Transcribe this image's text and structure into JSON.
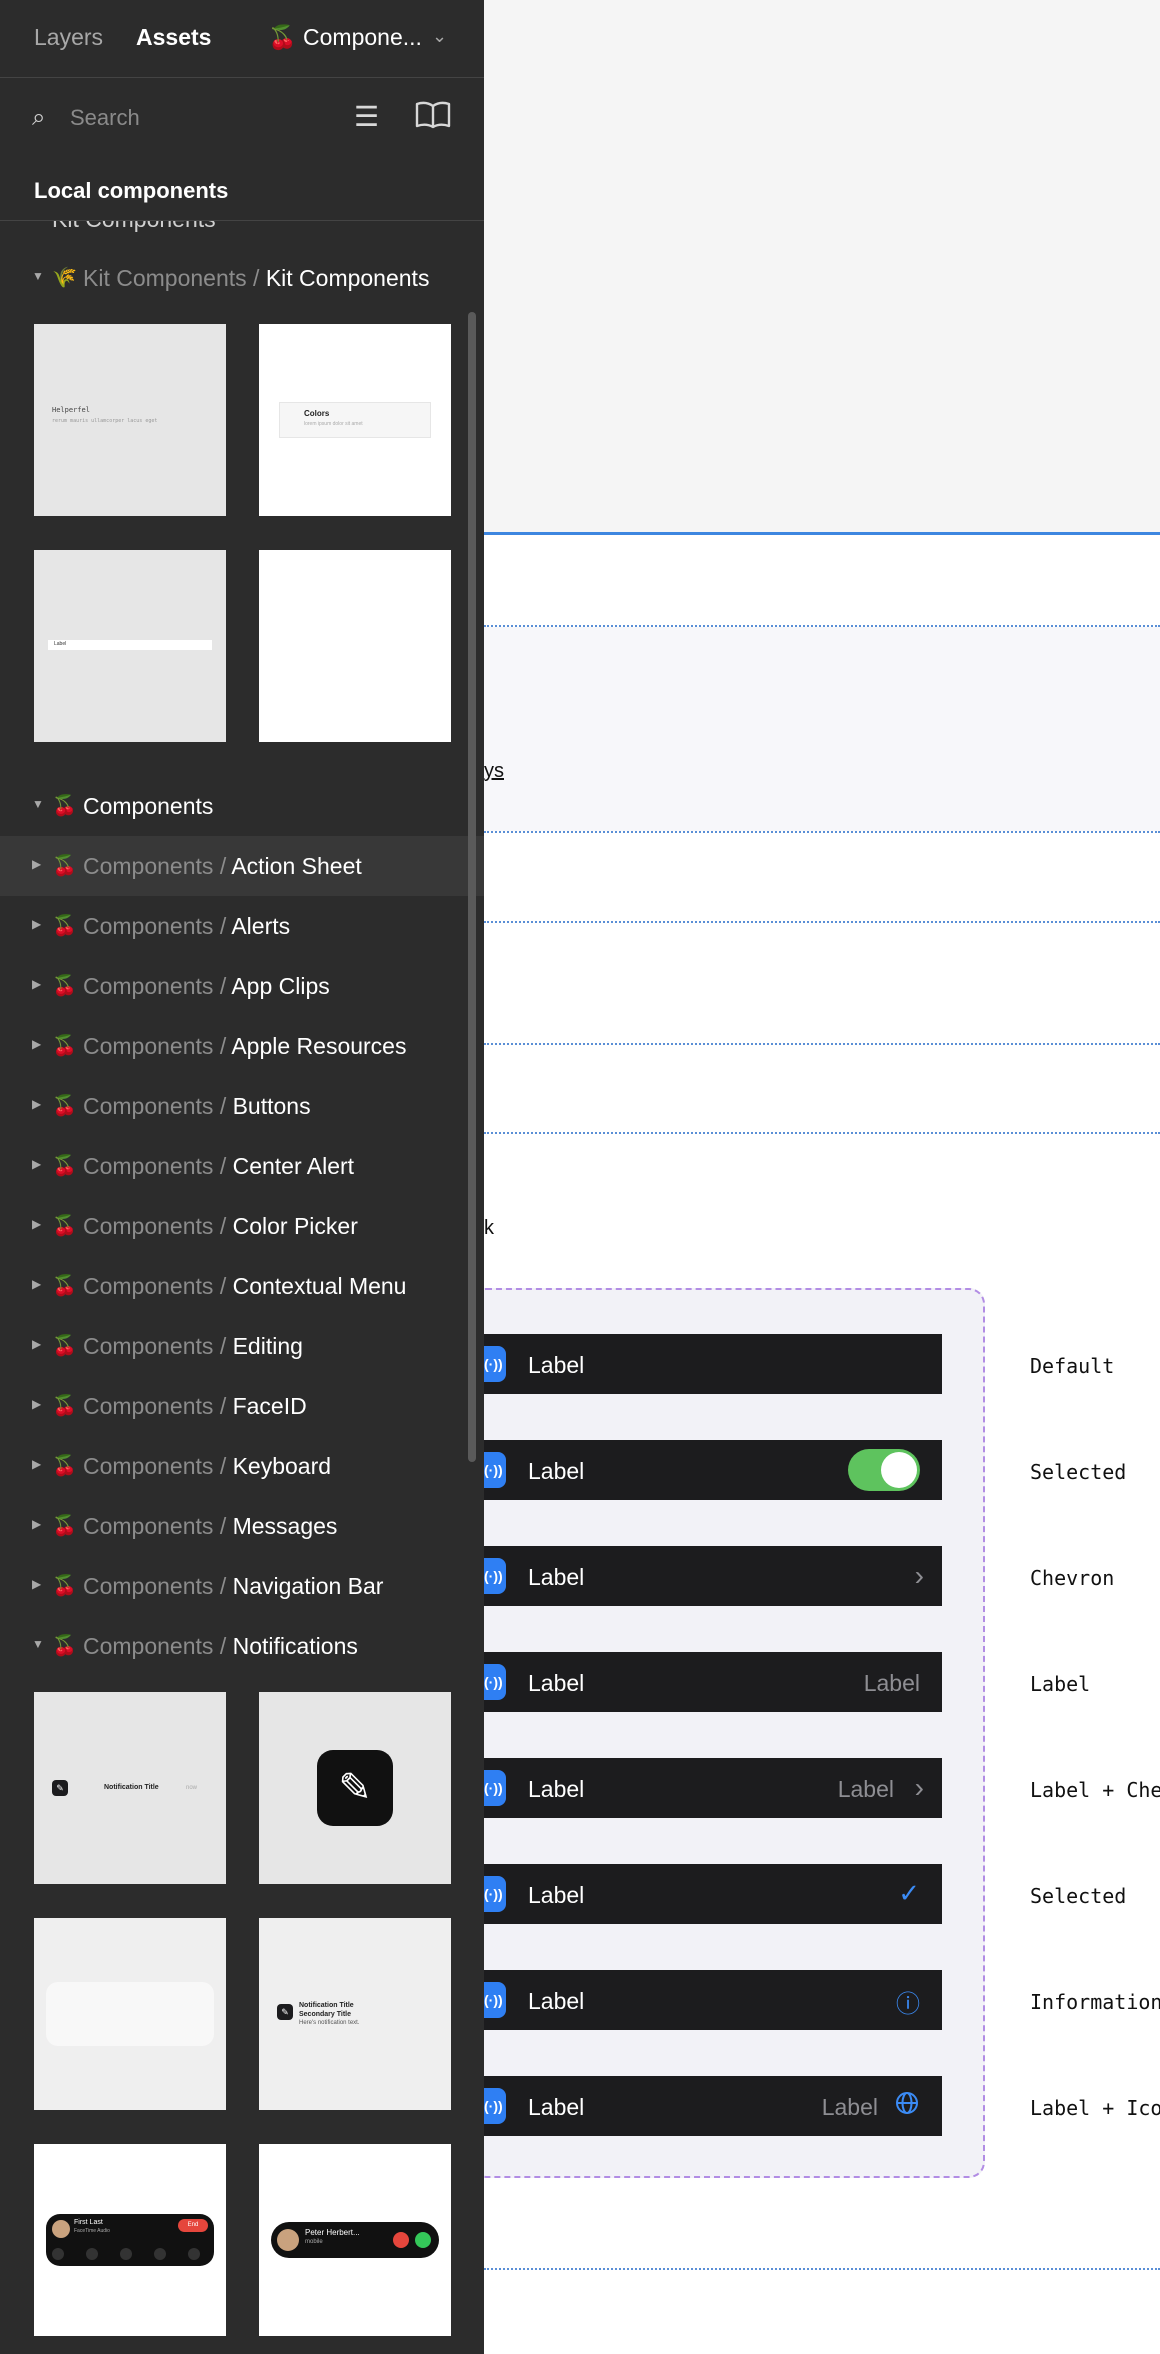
{
  "panel": {
    "tabs": [
      {
        "label": "Layers"
      },
      {
        "label": "Assets"
      }
    ],
    "library": {
      "icon": "🍒",
      "name": "Compone..."
    },
    "search": {
      "placeholder": "Search"
    },
    "section_title": "Local components",
    "clipped_group_label": "Kit Components",
    "kit_group": {
      "icon": "🌾",
      "prefix": "Kit Components",
      "name": "Kit Components"
    },
    "kit_thumbs": {
      "t1": {
        "title": "Helperfel",
        "sub": "rerum mauris ullamcorper  lacus  eget"
      },
      "t2": {
        "title": "Colors",
        "sub": "lorem ipsum dolor sit amet"
      },
      "t3": {
        "title": "Label"
      }
    },
    "components_group": {
      "icon": "🍒",
      "name": "Components"
    },
    "component_prefix": "Components",
    "separator": "/",
    "items": [
      {
        "name": "Action Sheet"
      },
      {
        "name": "Alerts"
      },
      {
        "name": "App Clips"
      },
      {
        "name": "Apple Resources"
      },
      {
        "name": "Buttons"
      },
      {
        "name": "Center Alert"
      },
      {
        "name": "Color Picker"
      },
      {
        "name": "Contextual Menu"
      },
      {
        "name": "Editing"
      },
      {
        "name": "FaceID"
      },
      {
        "name": "Keyboard"
      },
      {
        "name": "Messages"
      },
      {
        "name": "Navigation Bar"
      },
      {
        "name": "Notifications"
      }
    ],
    "notif_thumbs": {
      "t1": {
        "title": "Notification Title",
        "time": "now"
      },
      "t4": {
        "title": "Notification Title",
        "subtitle": "Secondary Title",
        "body": "Here's notification text."
      },
      "t5": {
        "name": "First Last",
        "status": "FaceTime Audio",
        "end": "End"
      },
      "t6": {
        "name": "Peter Herbert...",
        "sub": "mobile"
      }
    }
  },
  "canvas": {
    "fragment_1": "ys",
    "fragment_2": "k",
    "rows": [
      {
        "label": "Label",
        "state": "Default"
      },
      {
        "label": "Label",
        "state": "Selected"
      },
      {
        "label": "Label",
        "state": "Chevron"
      },
      {
        "label": "Label",
        "right_label": "Label",
        "state": "Label"
      },
      {
        "label": "Label",
        "right_label": "Label",
        "state": "Label + Che"
      },
      {
        "label": "Label",
        "state": "Selected"
      },
      {
        "label": "Label",
        "state": "Information"
      },
      {
        "label": "Label",
        "right_label": "Label",
        "state": "Label + Ico"
      }
    ]
  },
  "colors": {
    "panel_bg": "#2c2c2c",
    "accent_blue": "#3b8bf5",
    "toggle_green": "#5ec35e",
    "frame_purple": "#b28de4",
    "row_dark": "#1c1c1e"
  }
}
